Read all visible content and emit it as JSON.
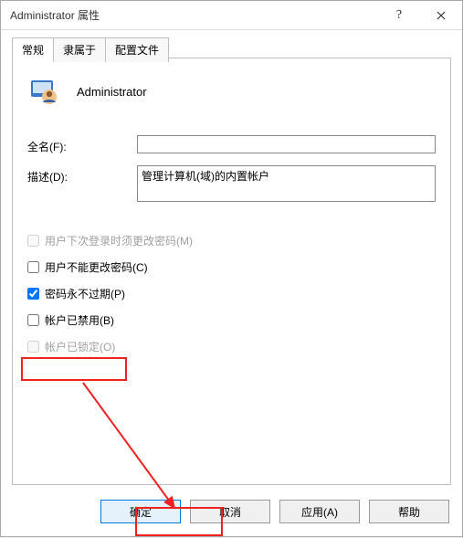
{
  "window": {
    "title": "Administrator 属性"
  },
  "tabs": {
    "t0": "常规",
    "t1": "隶属于",
    "t2": "配置文件"
  },
  "identity": {
    "name": "Administrator"
  },
  "fields": {
    "fullname_label": "全名(F):",
    "fullname_value": "",
    "desc_label": "描述(D):",
    "desc_value": "管理计算机(域)的内置帐户"
  },
  "checks": {
    "must_change": "用户下次登录时须更改密码(M)",
    "cannot_change": "用户不能更改密码(C)",
    "never_expire": "密码永不过期(P)",
    "disabled_acct": "帐户已禁用(B)",
    "locked": "帐户已锁定(O)"
  },
  "buttons": {
    "ok": "确定",
    "cancel": "取消",
    "apply": "应用(A)",
    "help": "帮助"
  }
}
